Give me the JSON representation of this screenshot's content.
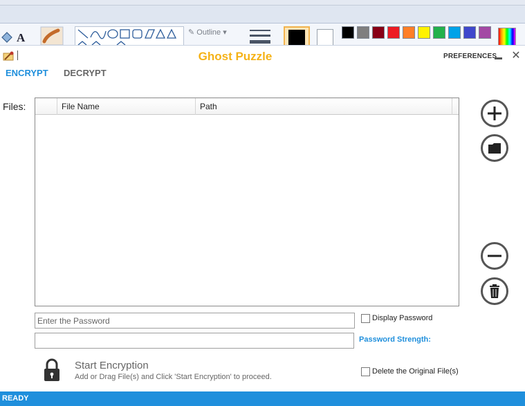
{
  "background_app": {
    "outline_label": "Outline",
    "palette_colors": [
      "#000000",
      "#7f7f7f",
      "#880015",
      "#ed1c24",
      "#ff7f27",
      "#fff200",
      "#22b14c",
      "#00a2e8",
      "#3f48cc",
      "#a349a4"
    ]
  },
  "window": {
    "title": "Ghost Puzzle",
    "preferences_label": "PREFERENCES",
    "minimize_icon": "minimize-icon",
    "close_icon": "close-icon"
  },
  "tabs": [
    {
      "label": "ENCRYPT",
      "active": true
    },
    {
      "label": "DECRYPT",
      "active": false
    }
  ],
  "files": {
    "label": "Files:",
    "columns": [
      "",
      "File Name",
      "Path",
      ""
    ],
    "rows": []
  },
  "side_buttons": {
    "add_icon": "plus-icon",
    "folder_icon": "folder-icon",
    "remove_icon": "minus-icon",
    "delete_icon": "trash-icon"
  },
  "password": {
    "placeholder": "Enter the Password",
    "value": "",
    "confirm_value": "",
    "display_password_label": "Display Password",
    "display_password_checked": false,
    "strength_label": "Password Strength:"
  },
  "action": {
    "title": "Start Encryption",
    "hint": "Add or Drag File(s) and Click 'Start Encryption' to proceed.",
    "delete_original_label": "Delete the Original File(s)",
    "delete_original_checked": false
  },
  "status": {
    "text": "READY"
  },
  "colors": {
    "accent": "#1f8fdc",
    "title": "#f5b217"
  }
}
